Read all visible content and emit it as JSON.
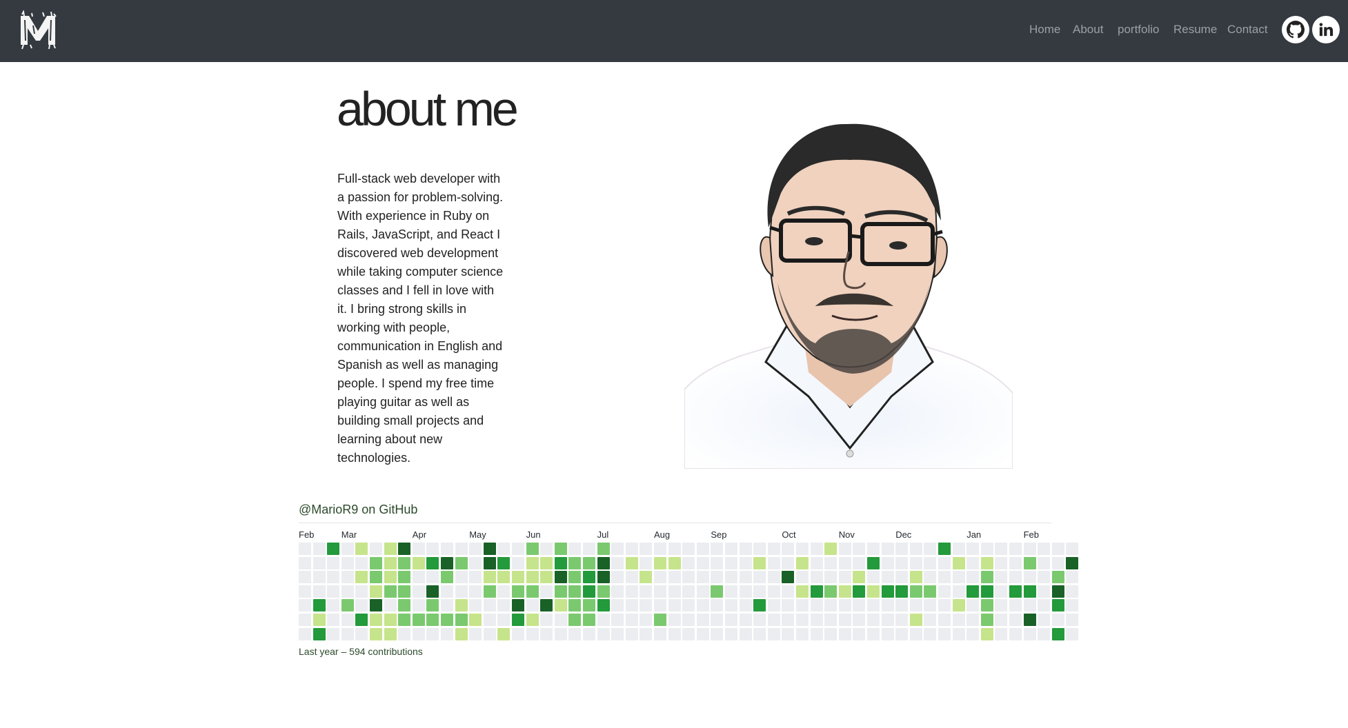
{
  "nav": {
    "logo_text": "M",
    "links": [
      {
        "label": "Home"
      },
      {
        "label": "About"
      },
      {
        "label": "portfolio"
      },
      {
        "label": "Resume"
      },
      {
        "label": "Contact"
      }
    ],
    "social": [
      {
        "icon": "github-icon"
      },
      {
        "icon": "linkedin-icon"
      }
    ]
  },
  "about": {
    "title": "about me",
    "bio": "Full-stack web developer with a passion for problem-solving. With experience in Ruby on Rails, JavaScript, and React I discovered web development while taking computer science classes and I fell in love with it. I bring strong skills in working with people, communication in English and Spanish as well as managing people. I spend my free time playing guitar as well as building small projects and learning about new technologies."
  },
  "github": {
    "heading": "@MarioR9 on GitHub",
    "footer": "Last year – 594 contributions",
    "months": [
      {
        "label": "Feb",
        "week": 0
      },
      {
        "label": "Mar",
        "week": 3
      },
      {
        "label": "Apr",
        "week": 8
      },
      {
        "label": "May",
        "week": 12
      },
      {
        "label": "Jun",
        "week": 16
      },
      {
        "label": "Jul",
        "week": 21
      },
      {
        "label": "Aug",
        "week": 25
      },
      {
        "label": "Sep",
        "week": 29
      },
      {
        "label": "Oct",
        "week": 34
      },
      {
        "label": "Nov",
        "week": 38
      },
      {
        "label": "Dec",
        "week": 42
      },
      {
        "label": "Jan",
        "week": 47
      },
      {
        "label": "Feb",
        "week": 51
      }
    ],
    "level_colors": [
      "#ebedf0",
      "#c6e48b",
      "#7bc96f",
      "#239a3b",
      "#196127"
    ],
    "contributions": [
      [
        0,
        0,
        0,
        0,
        0,
        0,
        0
      ],
      [
        0,
        0,
        0,
        0,
        3,
        1,
        3
      ],
      [
        3,
        0,
        0,
        0,
        0,
        0,
        0
      ],
      [
        0,
        0,
        0,
        0,
        2,
        0,
        0
      ],
      [
        1,
        0,
        1,
        0,
        0,
        3,
        0
      ],
      [
        0,
        2,
        2,
        1,
        4,
        1,
        1
      ],
      [
        1,
        1,
        1,
        2,
        0,
        1,
        1
      ],
      [
        4,
        2,
        2,
        2,
        2,
        2,
        0
      ],
      [
        0,
        1,
        0,
        0,
        0,
        2,
        0
      ],
      [
        0,
        3,
        0,
        4,
        2,
        2,
        0
      ],
      [
        0,
        4,
        2,
        0,
        0,
        2,
        0
      ],
      [
        0,
        2,
        0,
        0,
        1,
        2,
        1
      ],
      [
        0,
        0,
        0,
        0,
        0,
        1,
        0
      ],
      [
        4,
        4,
        1,
        2,
        0,
        0,
        0
      ],
      [
        0,
        3,
        1,
        0,
        0,
        0,
        1
      ],
      [
        0,
        0,
        1,
        2,
        4,
        3,
        0
      ],
      [
        2,
        1,
        1,
        2,
        0,
        1,
        0
      ],
      [
        0,
        1,
        1,
        0,
        4,
        0,
        0
      ],
      [
        2,
        3,
        4,
        2,
        1,
        0,
        0
      ],
      [
        0,
        2,
        2,
        2,
        2,
        2,
        0
      ],
      [
        0,
        2,
        3,
        3,
        2,
        2,
        0
      ],
      [
        2,
        4,
        4,
        2,
        3,
        0,
        0
      ],
      [
        0,
        0,
        0,
        0,
        0,
        0,
        0
      ],
      [
        0,
        1,
        0,
        0,
        0,
        0,
        0
      ],
      [
        0,
        0,
        1,
        0,
        0,
        0,
        0
      ],
      [
        0,
        1,
        0,
        0,
        0,
        2,
        0
      ],
      [
        0,
        1,
        0,
        0,
        0,
        0,
        0
      ],
      [
        0,
        0,
        0,
        0,
        0,
        0,
        0
      ],
      [
        0,
        0,
        0,
        0,
        0,
        0,
        0
      ],
      [
        0,
        0,
        0,
        2,
        0,
        0,
        0
      ],
      [
        0,
        0,
        0,
        0,
        0,
        0,
        0
      ],
      [
        0,
        0,
        0,
        0,
        0,
        0,
        0
      ],
      [
        0,
        1,
        0,
        0,
        3,
        0,
        0
      ],
      [
        0,
        0,
        0,
        0,
        0,
        0,
        0
      ],
      [
        0,
        0,
        4,
        0,
        0,
        0,
        0
      ],
      [
        0,
        1,
        0,
        1,
        0,
        0,
        0
      ],
      [
        0,
        0,
        0,
        3,
        0,
        0,
        0
      ],
      [
        1,
        0,
        0,
        2,
        0,
        0,
        0
      ],
      [
        0,
        0,
        0,
        1,
        0,
        0,
        0
      ],
      [
        0,
        0,
        1,
        3,
        0,
        0,
        0
      ],
      [
        0,
        3,
        0,
        1,
        0,
        0,
        0
      ],
      [
        0,
        0,
        0,
        3,
        0,
        0,
        0
      ],
      [
        0,
        0,
        0,
        3,
        0,
        0,
        0
      ],
      [
        0,
        0,
        1,
        2,
        0,
        1,
        0
      ],
      [
        0,
        0,
        0,
        2,
        0,
        0,
        0
      ],
      [
        3,
        0,
        0,
        0,
        0,
        0,
        0
      ],
      [
        0,
        1,
        0,
        0,
        1,
        0,
        0
      ],
      [
        0,
        0,
        0,
        3,
        0,
        0,
        0
      ],
      [
        0,
        1,
        2,
        3,
        2,
        2,
        1
      ],
      [
        0,
        0,
        0,
        0,
        0,
        0,
        0
      ],
      [
        0,
        0,
        0,
        3,
        0,
        0,
        0
      ],
      [
        0,
        2,
        0,
        3,
        0,
        4,
        0
      ],
      [
        0,
        0,
        0,
        0,
        0,
        0,
        0
      ],
      [
        0,
        0,
        2,
        4,
        3,
        0,
        3
      ],
      [
        0,
        4,
        0,
        0,
        0,
        0,
        0
      ]
    ]
  }
}
